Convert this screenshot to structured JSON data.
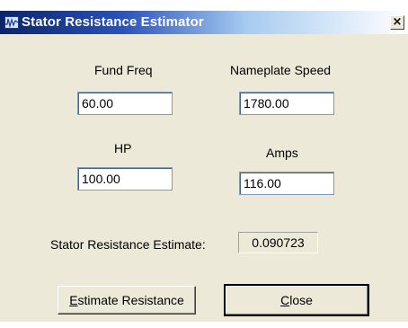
{
  "window": {
    "title": "Stator Resistance Estimator",
    "close_glyph": "×",
    "icon": "waveform-icon"
  },
  "fields": {
    "fund_freq": {
      "label": "Fund Freq",
      "value": "60.00"
    },
    "nameplate_speed": {
      "label": "Nameplate Speed",
      "value": "1780.00"
    },
    "hp": {
      "label": "HP",
      "value": "100.00"
    },
    "amps": {
      "label": "Amps",
      "value": "116.00"
    }
  },
  "result": {
    "label": "Stator Resistance Estimate:",
    "value": "0.090723"
  },
  "buttons": {
    "estimate": {
      "mnemonic": "E",
      "rest": "stimate Resistance"
    },
    "close": {
      "mnemonic": "C",
      "rest": "lose"
    }
  }
}
